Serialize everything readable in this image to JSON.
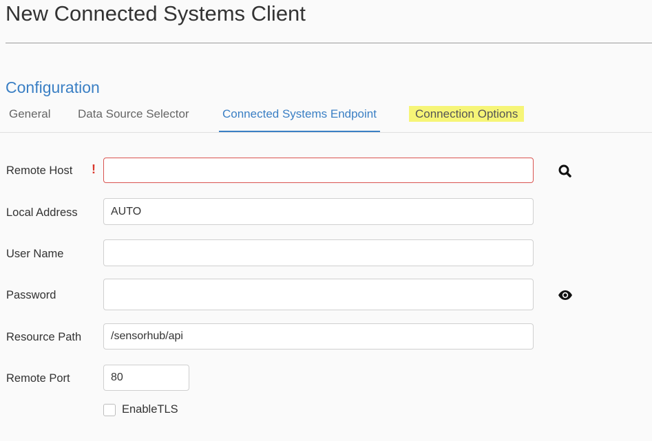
{
  "page": {
    "title": "New Connected Systems Client"
  },
  "section": {
    "heading": "Configuration"
  },
  "tabs": [
    {
      "label": "General",
      "active": false
    },
    {
      "label": "Data Source Selector",
      "active": false
    },
    {
      "label": "Connected Systems Endpoint",
      "active": true
    },
    {
      "label": "Connection Options",
      "active": false,
      "highlighted": true
    }
  ],
  "form": {
    "remote_host": {
      "label": "Remote Host",
      "value": "",
      "required_mark": "!"
    },
    "local_address": {
      "label": "Local Address",
      "value": "AUTO"
    },
    "user_name": {
      "label": "User Name",
      "value": ""
    },
    "password": {
      "label": "Password",
      "value": ""
    },
    "resource_path": {
      "label": "Resource Path",
      "value": "/sensorhub/api"
    },
    "remote_port": {
      "label": "Remote Port",
      "value": "80"
    },
    "enable_tls": {
      "label": "EnableTLS",
      "checked": false
    }
  },
  "icons": {
    "search": "search-icon",
    "reveal_password": "eye-icon"
  },
  "colors": {
    "accent": "#3a7fc4",
    "error": "#d9534f",
    "highlight": "#f6f577"
  }
}
